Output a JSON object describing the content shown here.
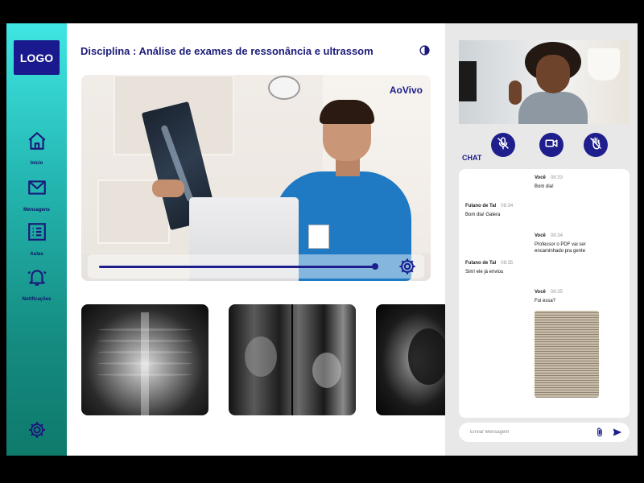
{
  "sidebar": {
    "logo": "LOGO",
    "items": [
      {
        "label": "Início",
        "icon": "home-icon"
      },
      {
        "label": "Mensagens",
        "icon": "mail-icon"
      },
      {
        "label": "Aulas",
        "icon": "list-icon"
      },
      {
        "label": "Notificações",
        "icon": "bell-icon"
      }
    ],
    "settings_icon": "gear-icon"
  },
  "main": {
    "title": "Disciplina : Análise de exames de ressonância e ultrassom",
    "theme_icon": "brightness-icon",
    "video": {
      "live_label": "AoVivo",
      "progress": 0.95,
      "settings_icon": "gear-icon"
    },
    "thumbnails": [
      {
        "icon": "chest-xray-image"
      },
      {
        "icon": "mri-scan-image"
      },
      {
        "icon": "ultrasound-image"
      }
    ]
  },
  "call": {
    "buttons": [
      {
        "icon": "mic-off-icon"
      },
      {
        "icon": "video-camera-icon"
      },
      {
        "icon": "hand-off-icon"
      }
    ]
  },
  "chat": {
    "label": "CHAT",
    "messages": [
      {
        "author": "Você",
        "time": "08:33",
        "text": "Bom dia!"
      },
      {
        "author": "Fulano de Tal",
        "time": "08:34",
        "text": "Bom dia! Galera"
      },
      {
        "author": "Você",
        "time": "08:34",
        "text": "Professor o PDF vai ser encaminhado pra gente"
      },
      {
        "author": "Fulano de Tal",
        "time": "08:35",
        "text": "Sim! ele já enviou"
      },
      {
        "author": "Você",
        "time": "08:35",
        "text": "Foi essa?"
      }
    ],
    "input": {
      "placeholder": "Enviar Mensagem"
    },
    "attach_icon": "paperclip-icon",
    "send_icon": "send-icon"
  },
  "colors": {
    "accent": "#1e1e8c",
    "sidebar_top": "#3fe6e3",
    "sidebar_bottom": "#0e7a6c"
  }
}
